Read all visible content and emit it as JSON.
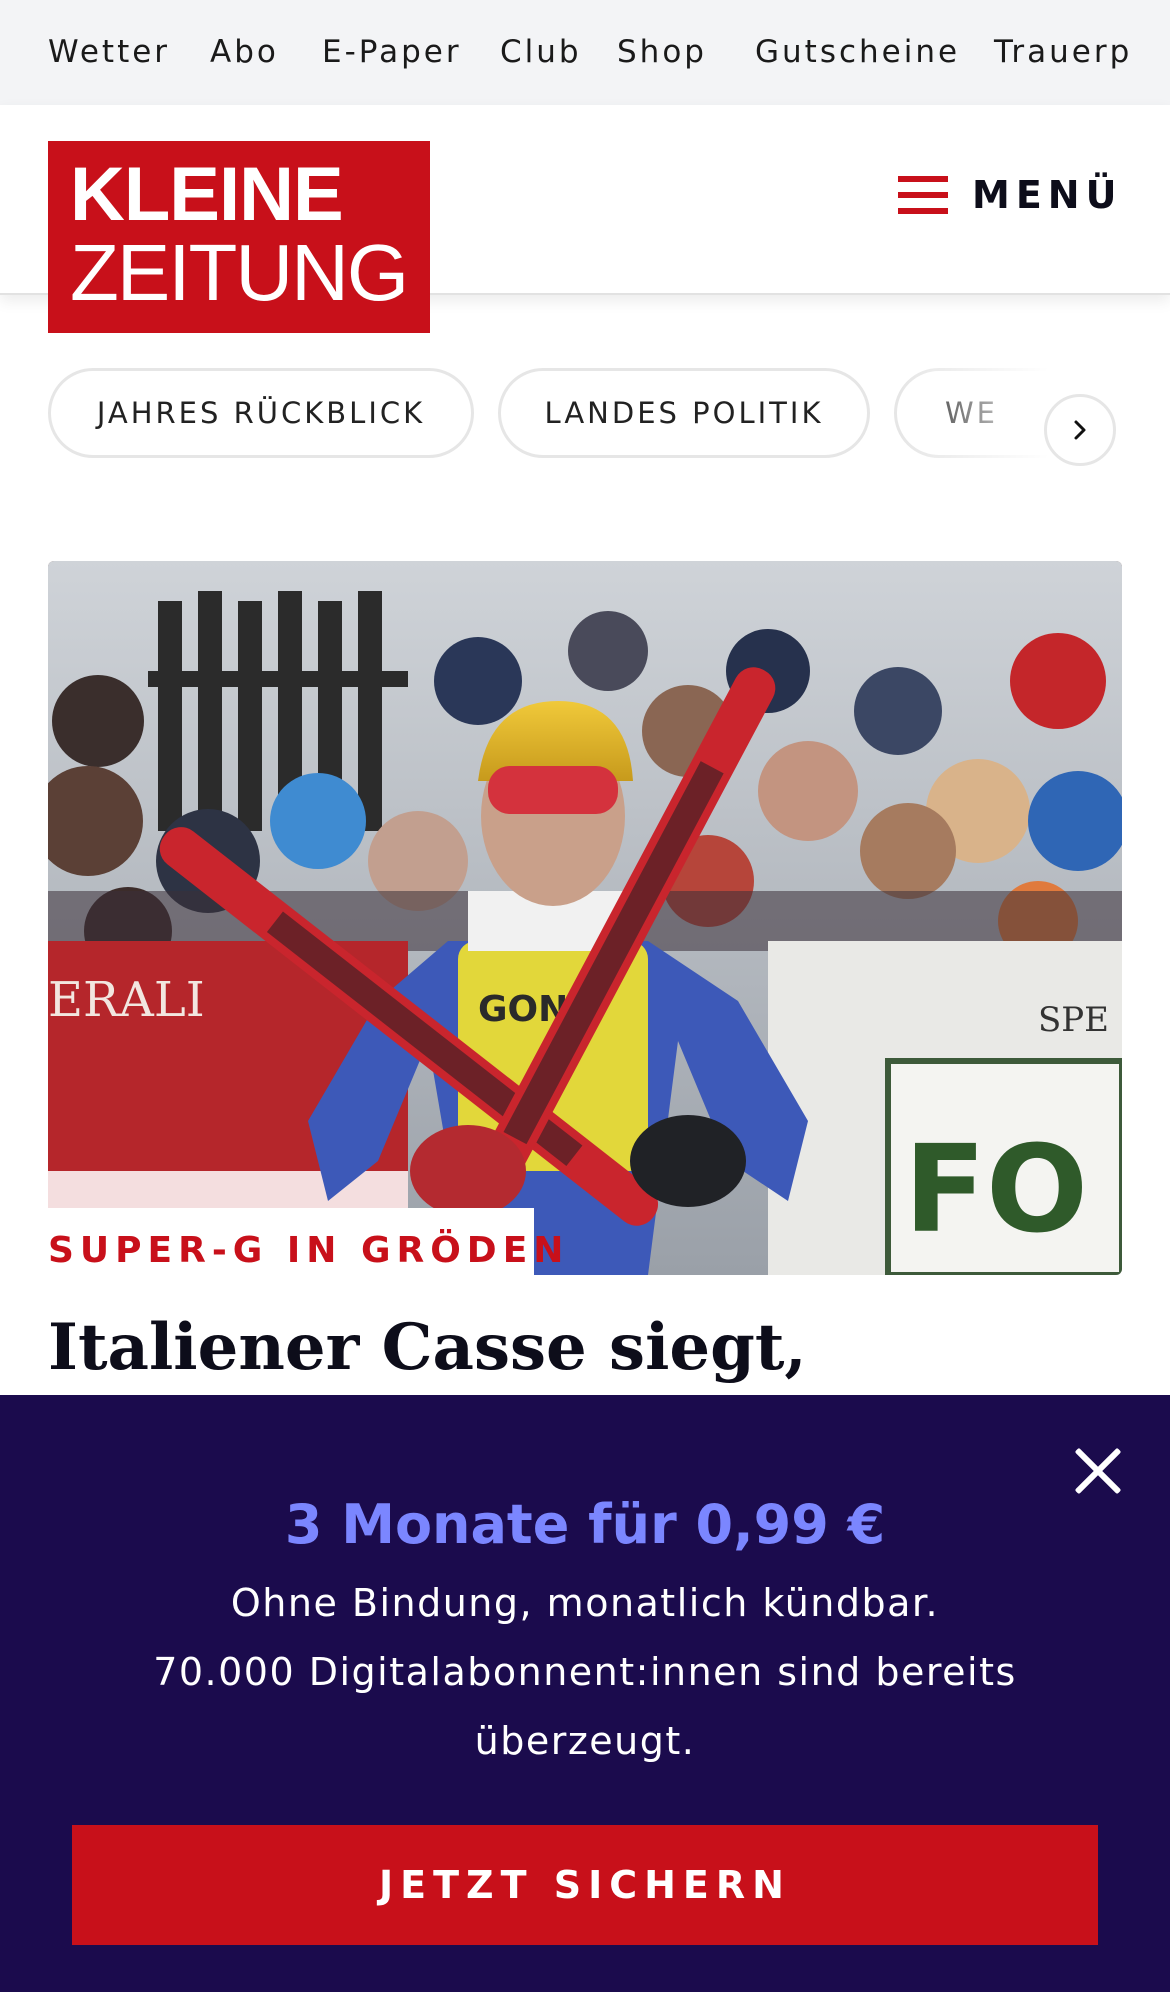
{
  "top_nav": {
    "items": [
      "Wetter",
      "Abo",
      "E-Paper",
      "Club",
      "Shop",
      "Gutscheine",
      "Trauerp"
    ]
  },
  "header": {
    "logo_line1": "KLEINE",
    "logo_line2": "ZEITUNG",
    "menu_label": "MENÜ",
    "hamburger_icon": "hamburger-icon",
    "brand_color": "#c8101a"
  },
  "tags": {
    "items": [
      "JAHRES RÜCKBLICK",
      "LANDES POLITIK",
      "WE"
    ],
    "next_icon": "chevron-right-icon"
  },
  "article": {
    "kicker": "SUPER-G IN GRÖDEN",
    "headline": "Italiener Casse siegt,"
  },
  "paywall": {
    "offer": "3 Monate für 0,99 €",
    "line1": "Ohne Bindung, monatlich kündbar.",
    "line2": "70.000 Digitalabonnent:innen sind bereits",
    "line3": "überzeugt.",
    "cta_label": "JETZT SICHERN",
    "close_icon": "close-icon",
    "background_color": "#1b0b4d",
    "offer_color": "#7b86ff"
  }
}
